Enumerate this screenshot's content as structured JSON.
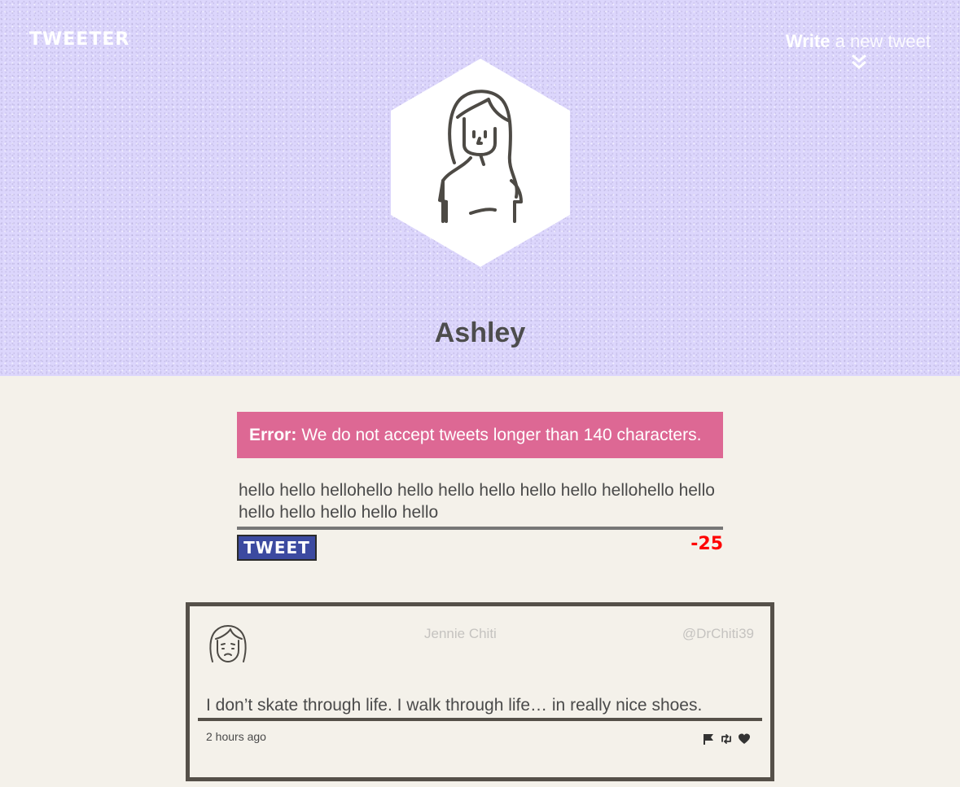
{
  "nav": {
    "logo": "TWEETER",
    "write_bold": "Write",
    "write_rest": " a new tweet",
    "toggle_icon": "chevrons-down-icon"
  },
  "profile": {
    "name": "Ashley",
    "avatar_icon": "girl-avatar-icon"
  },
  "error": {
    "label": "Error:",
    "message": "We do not accept tweets longer than 140 characters."
  },
  "compose": {
    "text": "hello hello hellohello hello hello hello hello hello hellohello hello hello hello hello hello hello",
    "button_label": "TWEET",
    "counter": "-25"
  },
  "tweets": [
    {
      "name": "Jennie Chiti",
      "handle": "@DrChiti39",
      "content": "I don’t skate through life. I walk through life… in really nice shoes.",
      "time": "2 hours ago",
      "avatar_icon": "sad-girl-avatar-icon",
      "actions": [
        "flag-icon",
        "retweet-icon",
        "heart-icon"
      ]
    }
  ],
  "colors": {
    "header_bg": "#dcd6fc",
    "page_bg": "#f4f1ea",
    "error_bg": "#dd6894",
    "button_bg": "#3c4aa0",
    "counter": "#ff0000",
    "border": "#555049"
  }
}
